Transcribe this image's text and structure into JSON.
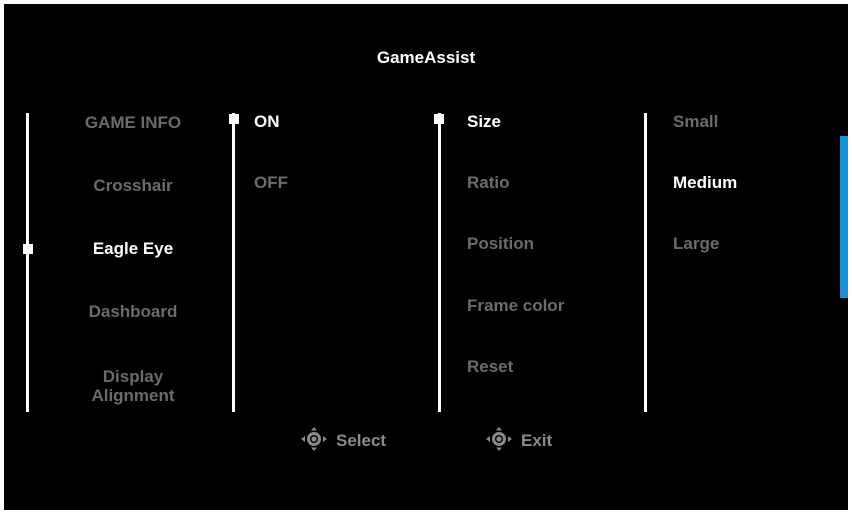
{
  "title": "GameAssist",
  "main_menu": {
    "items": [
      {
        "label": "GAME INFO"
      },
      {
        "label": "Crosshair"
      },
      {
        "label": "Eagle Eye",
        "selected": true
      },
      {
        "label": "Dashboard"
      },
      {
        "label": "Display\nAlignment"
      }
    ]
  },
  "toggle_menu": {
    "items": [
      {
        "label": "ON",
        "selected": true
      },
      {
        "label": "OFF"
      }
    ]
  },
  "settings_menu": {
    "items": [
      {
        "label": "Size",
        "selected": true
      },
      {
        "label": "Ratio"
      },
      {
        "label": "Position"
      },
      {
        "label": "Frame color"
      },
      {
        "label": "Reset"
      }
    ]
  },
  "size_options": {
    "items": [
      {
        "label": "Small"
      },
      {
        "label": "Medium",
        "selected": true
      },
      {
        "label": "Large"
      }
    ]
  },
  "hints": {
    "select": "Select",
    "exit": "Exit"
  },
  "colors": {
    "background": "#000000",
    "active_text": "#ffffff",
    "inactive_text": "#6b6b6b",
    "scrollbar": "#1a8fd8"
  },
  "icons": {
    "select": "joystick-select-icon",
    "exit": "joystick-exit-icon"
  }
}
